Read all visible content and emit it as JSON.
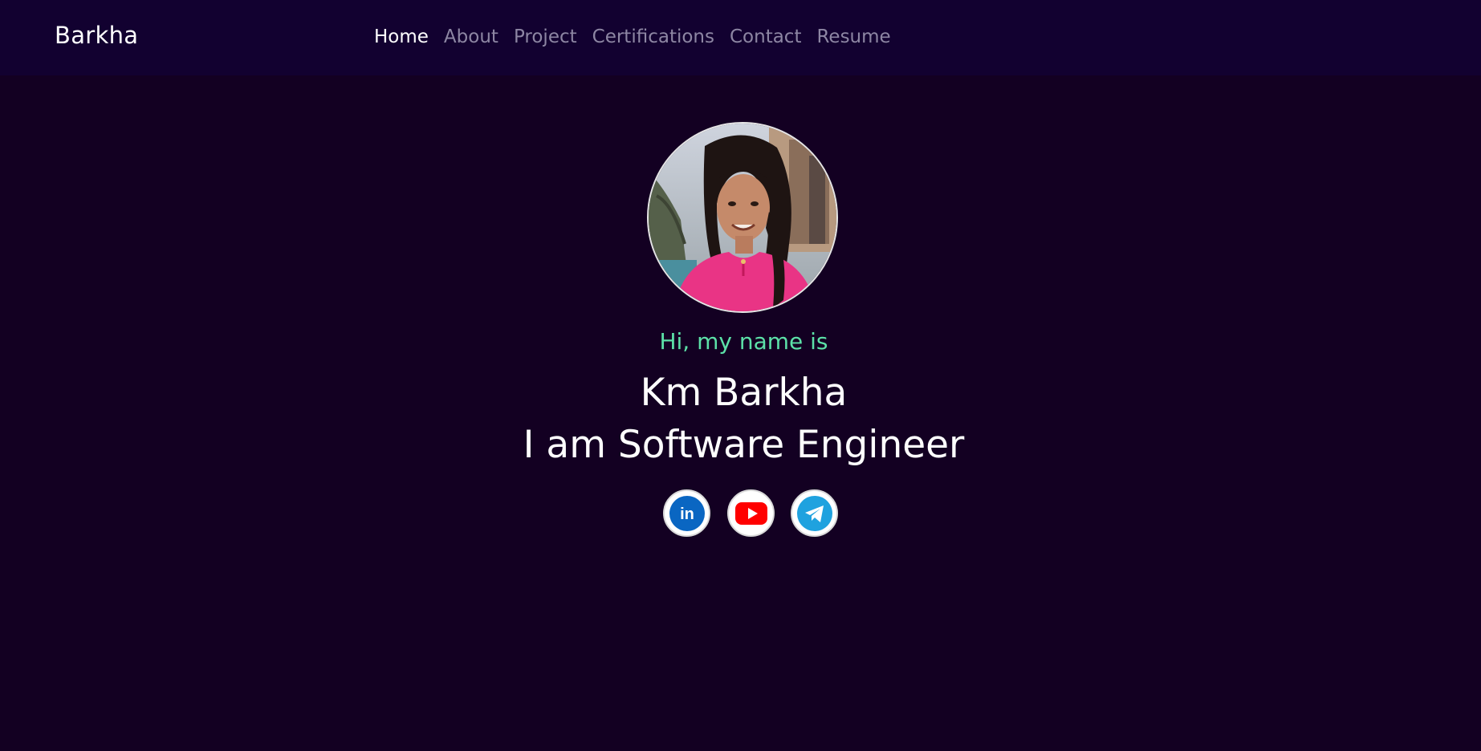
{
  "nav": {
    "brand": "Barkha",
    "links": [
      {
        "label": "Home",
        "active": true
      },
      {
        "label": "About",
        "active": false
      },
      {
        "label": "Project",
        "active": false
      },
      {
        "label": "Certifications",
        "active": false
      },
      {
        "label": "Contact",
        "active": false
      },
      {
        "label": "Resume",
        "active": false
      }
    ]
  },
  "hero": {
    "greeting": "Hi, my name is",
    "name": "Km Barkha",
    "role": "I am Software Engineer",
    "socials": [
      {
        "network": "linkedin",
        "icon": "linkedin-icon",
        "glyph": "in"
      },
      {
        "network": "youtube",
        "icon": "youtube-icon"
      },
      {
        "network": "telegram",
        "icon": "telegram-icon"
      }
    ]
  },
  "colors": {
    "background": "#130022",
    "navbar": "#120130",
    "accent": "#5ce1a8",
    "nav_inactive": "#8d86a3",
    "linkedin": "#0a66c2",
    "youtube": "#ff0000",
    "telegram": "#1fa2df"
  }
}
